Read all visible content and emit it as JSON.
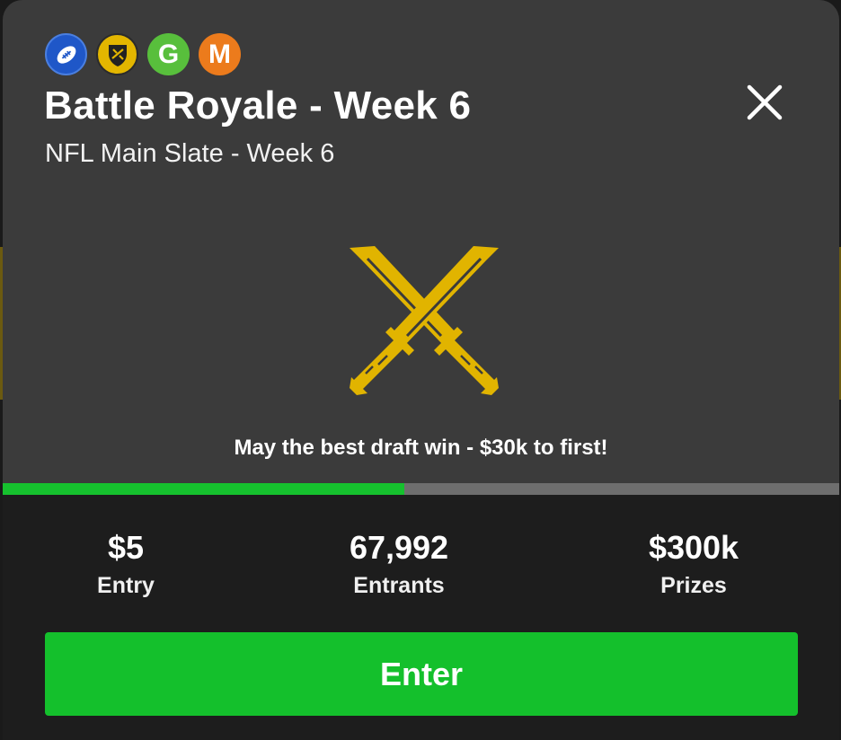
{
  "contest": {
    "title": "Battle Royale - Week 6",
    "subtitle": "NFL Main Slate - Week 6",
    "tagline": "May the best draft win - $30k to first!"
  },
  "badges": [
    {
      "icon": "football-icon",
      "letter": "",
      "color": "#1f57c8"
    },
    {
      "icon": "shield-icon",
      "letter": "",
      "color": "#e3b600"
    },
    {
      "icon": "g-badge-icon",
      "letter": "G",
      "color": "#58bf3c"
    },
    {
      "icon": "m-badge-icon",
      "letter": "M",
      "color": "#ec7b1c"
    }
  ],
  "fill_progress": 0.48,
  "stats": {
    "entry": {
      "value": "$5",
      "label": "Entry"
    },
    "entrants": {
      "value": "67,992",
      "label": "Entrants"
    },
    "prizes": {
      "value": "$300k",
      "label": "Prizes"
    }
  },
  "actions": {
    "enter_label": "Enter"
  },
  "colors": {
    "accent_green": "#14c02c",
    "sword_gold": "#e1b400",
    "card_top": "#3b3b3b",
    "card_bottom": "#1d1d1d"
  }
}
